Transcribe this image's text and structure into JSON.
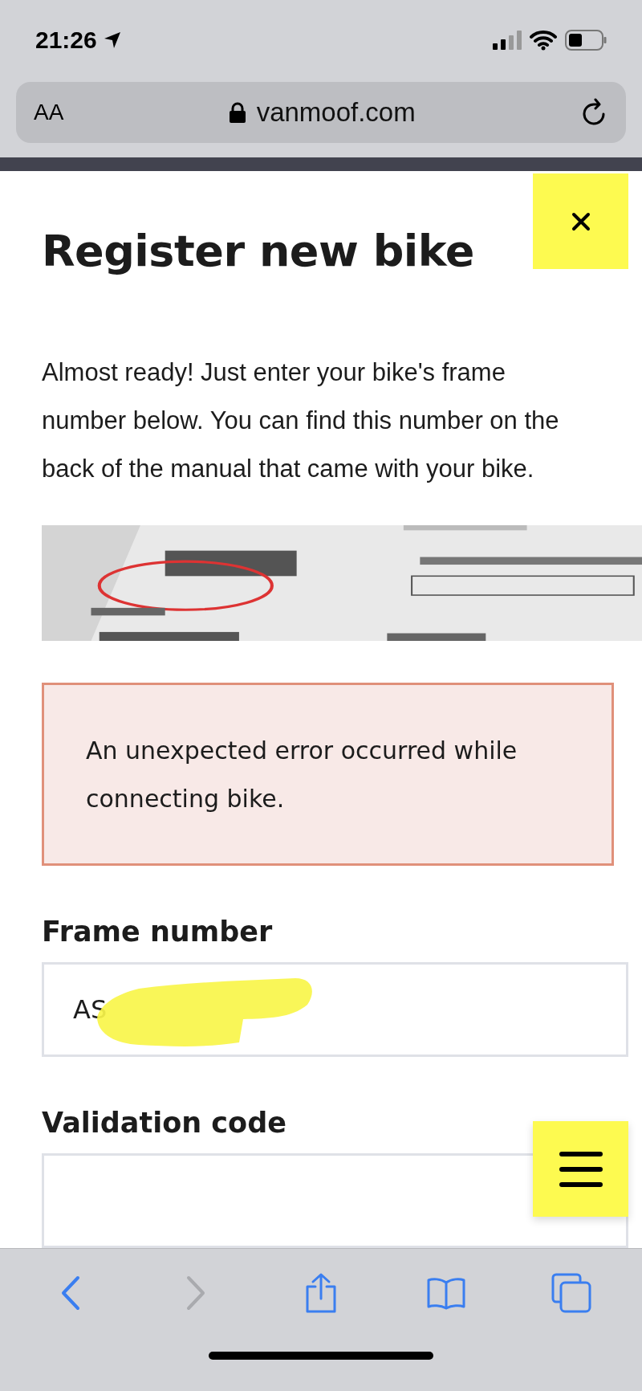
{
  "status_bar": {
    "time": "21:26"
  },
  "address_bar": {
    "text_size_button": "AA",
    "url": "vanmoof.com"
  },
  "page": {
    "title": "Register new bike",
    "intro": "Almost ready! Just enter your bike's frame number below. You can find this number on the back of the manual that came with your bike.",
    "error": "An unexpected error occurred while connecting bike.",
    "fields": [
      {
        "label": "Frame number",
        "value": "AS",
        "redacted": true
      },
      {
        "label": "Validation code"
      }
    ]
  },
  "toolbar": [
    {
      "kind": "back",
      "disabled": false
    },
    {
      "kind": "forward",
      "disabled": true
    },
    {
      "kind": "share",
      "disabled": false
    },
    {
      "kind": "bookmarks",
      "disabled": false
    },
    {
      "kind": "tabs",
      "disabled": false
    }
  ]
}
